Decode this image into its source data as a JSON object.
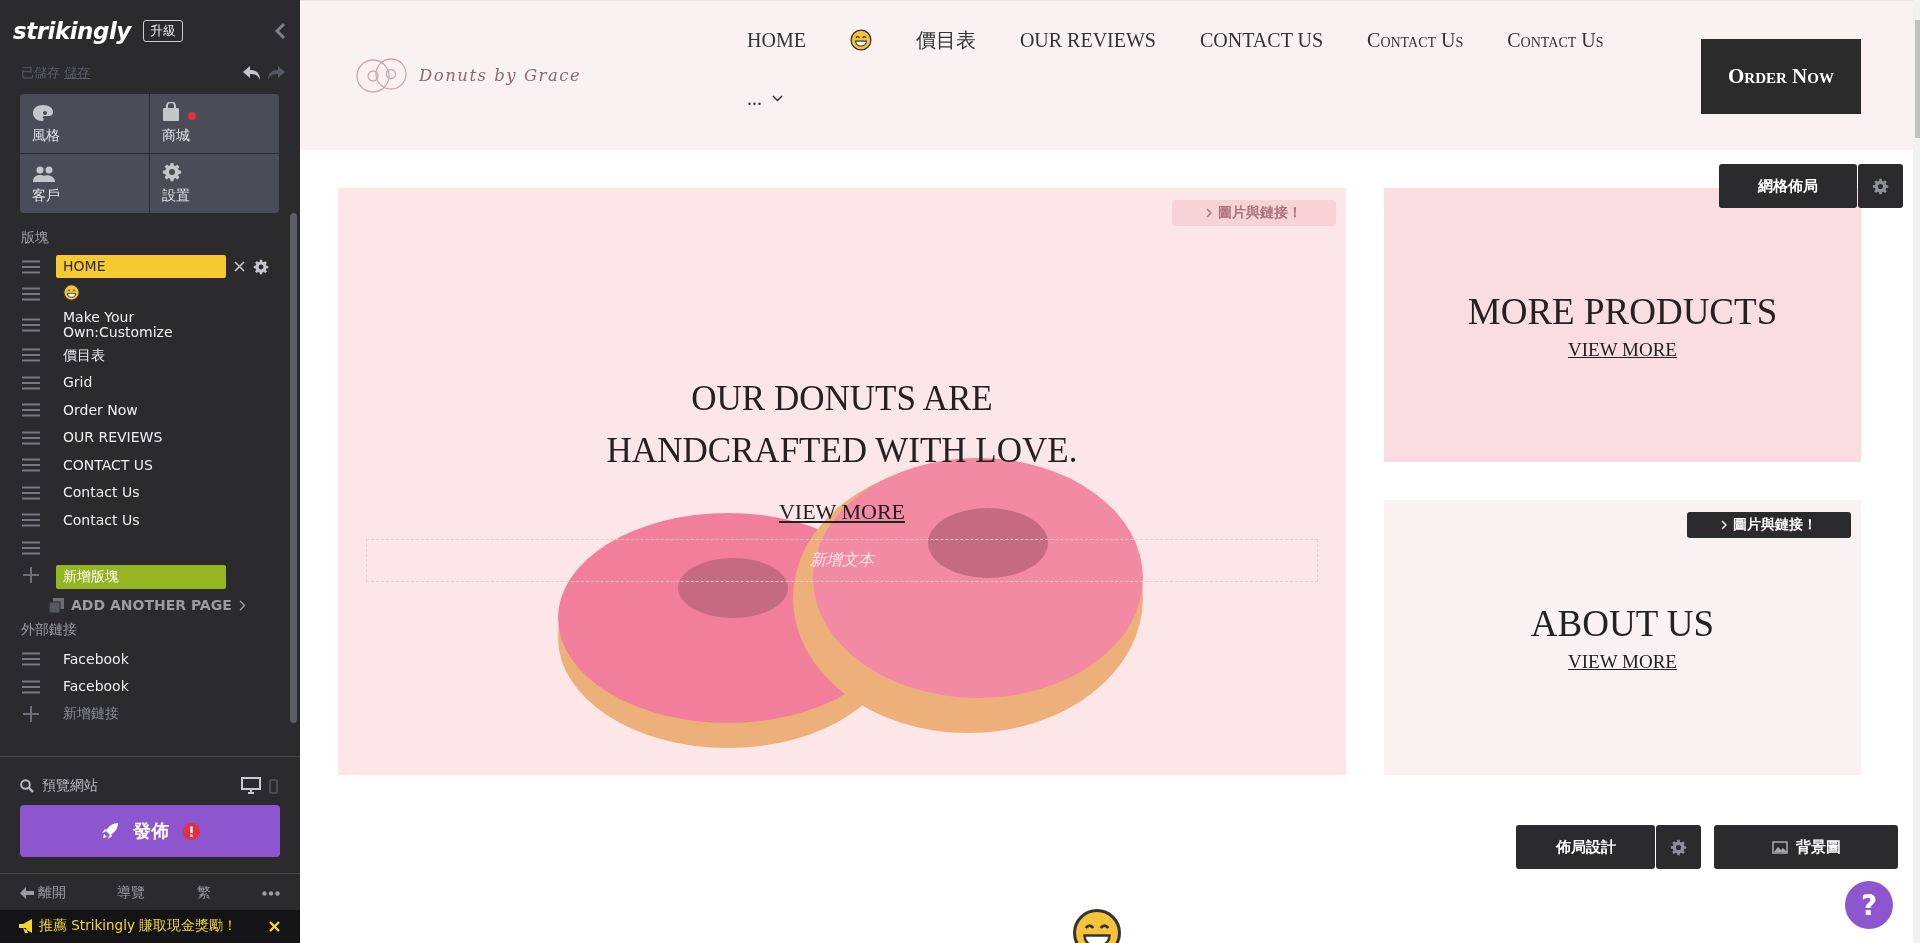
{
  "editor": {
    "logo": "strikingly",
    "upgrade": "升級",
    "save_status": "已儲存",
    "save_link": "儲存",
    "tiles": [
      {
        "kind": "palette",
        "label": "風格",
        "alert": false
      },
      {
        "kind": "bag",
        "label": "商城",
        "alert": true
      },
      {
        "kind": "people",
        "label": "客戶",
        "alert": false
      },
      {
        "kind": "gear",
        "label": "設置",
        "alert": false
      }
    ],
    "sections_heading": "版塊",
    "sections": [
      {
        "kind": "text",
        "label": "HOME",
        "selected": true
      },
      {
        "kind": "emoji",
        "selected": false
      },
      {
        "kind": "text",
        "label": "Make Your Own:Customize",
        "selected": false
      },
      {
        "kind": "text",
        "label": "價目表",
        "selected": false
      },
      {
        "kind": "text",
        "label": "Grid",
        "selected": false
      },
      {
        "kind": "text",
        "label": "Order Now",
        "selected": false
      },
      {
        "kind": "text",
        "label": "OUR REVIEWS",
        "selected": false
      },
      {
        "kind": "text",
        "label": "CONTACT US",
        "selected": false
      },
      {
        "kind": "text",
        "label": "Contact Us",
        "selected": false
      },
      {
        "kind": "text",
        "label": "Contact Us",
        "selected": false
      },
      {
        "kind": "blank",
        "selected": false
      }
    ],
    "add_section": "新增版塊",
    "add_page": "ADD ANOTHER PAGE",
    "links_heading": "外部鏈接",
    "links": [
      "Facebook",
      "Facebook"
    ],
    "add_link": "新增鏈接",
    "preview": "預覽網站",
    "devices": [
      {
        "kind": "desktop",
        "selected": true
      },
      {
        "kind": "mobile",
        "selected": false
      }
    ],
    "publish": "發佈",
    "publish_alert": true,
    "footer_nav": [
      "離開",
      "導覽",
      "繁"
    ],
    "promo": "推薦 Strikingly 賺取現金獎勵！"
  },
  "site": {
    "brand": "Donuts by Grace",
    "nav": [
      {
        "kind": "text",
        "label": "HOME"
      },
      {
        "kind": "emoji"
      },
      {
        "kind": "text",
        "label": "價目表"
      },
      {
        "kind": "text",
        "label": "OUR REVIEWS"
      },
      {
        "kind": "text",
        "label": "CONTACT US"
      },
      {
        "kind": "text",
        "label": "Contact Us"
      },
      {
        "kind": "text",
        "label": "Contact Us"
      },
      {
        "kind": "more",
        "label": "..."
      }
    ],
    "order_button": "Order Now",
    "hero": {
      "heading": "OUR DONUTS ARE HANDCRAFTED WITH LOVE.",
      "link": "VIEW MORE",
      "text_placeholder": "新增文本",
      "tag": {
        "label": "圖片與鏈接！",
        "faded": true
      }
    },
    "cards": [
      {
        "title": "MORE PRODUCTS",
        "link": "VIEW MORE",
        "color": "#f9dde0"
      },
      {
        "title": "ABOUT US",
        "link": "VIEW MORE",
        "color": "#faf1f2",
        "tag": {
          "label": "圖片與鏈接！",
          "faded": false
        }
      }
    ],
    "grid_button": "網格佈局",
    "layout_button": "佈局設計",
    "background_button": "背景圖",
    "help": "?"
  }
}
